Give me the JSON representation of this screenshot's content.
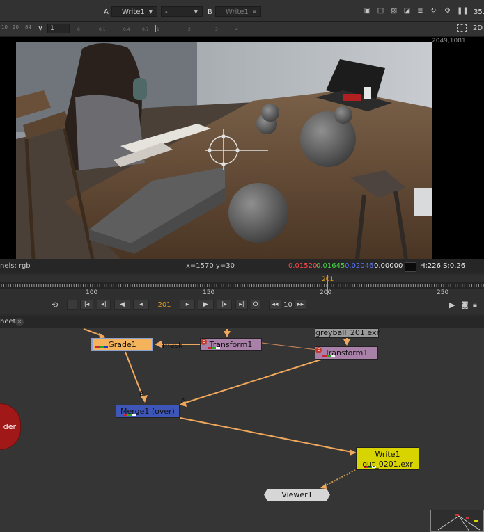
{
  "toolbar": {
    "input_a_letter": "A",
    "input_a_value": "Write1",
    "wipe_value": "-",
    "input_b_letter": "B",
    "input_b_value": "Write1",
    "fstop_value": "35.",
    "view_mode": "2D",
    "gain_ticks": [
      "10",
      "20",
      "84"
    ],
    "gamma_label": "y",
    "gamma_value": "1",
    "gamma_ticks": [
      "0",
      "0.1",
      "0.4",
      "0.7",
      "1",
      "2",
      "3",
      "4"
    ]
  },
  "viewer": {
    "format_label": "2049,1081",
    "channels_text": "nels: rgb",
    "coords_text": "x=1570 y=30",
    "red_value": "0.01520",
    "green_value": "0.01645",
    "blue_value": "0.02046",
    "alpha_value": "0.00000",
    "hsv_text": "H:226 S:0.26 V:0.02"
  },
  "timeline": {
    "current_frame": "201",
    "tick_labels": [
      "100",
      "150",
      "200",
      "250"
    ],
    "frame_field": "201",
    "increment_field": "10",
    "buttons": [
      "I",
      "|◂",
      "◂|",
      "◀",
      "◂",
      "▸",
      "▶",
      "|▸",
      "▸|",
      "O",
      "◂◂",
      "▸▸"
    ]
  },
  "nodegraph": {
    "tab_label": "heet",
    "mask_label": "mask",
    "input_b_label": "B",
    "input_a_label": "A",
    "nodes": {
      "grade": "Grade1",
      "transform_top": "Transform1",
      "read": "greyball_201.exr",
      "transform_right": "Transform1",
      "merge": "Merge1 (over)",
      "write_title": "Write1",
      "write_file": "out_0201.exr",
      "viewer": "Viewer1",
      "render_partial": "der"
    }
  },
  "colors": {
    "grade_node": "#f5b45c",
    "transform_node": "#a980a8",
    "merge_node": "#3e56b8",
    "write_node": "#d8d400",
    "pipe": "#f0a85c",
    "red_readout": "#ff4040",
    "green_readout": "#40d840",
    "blue_readout": "#4a6cff",
    "current_frame": "#e49b1d"
  }
}
